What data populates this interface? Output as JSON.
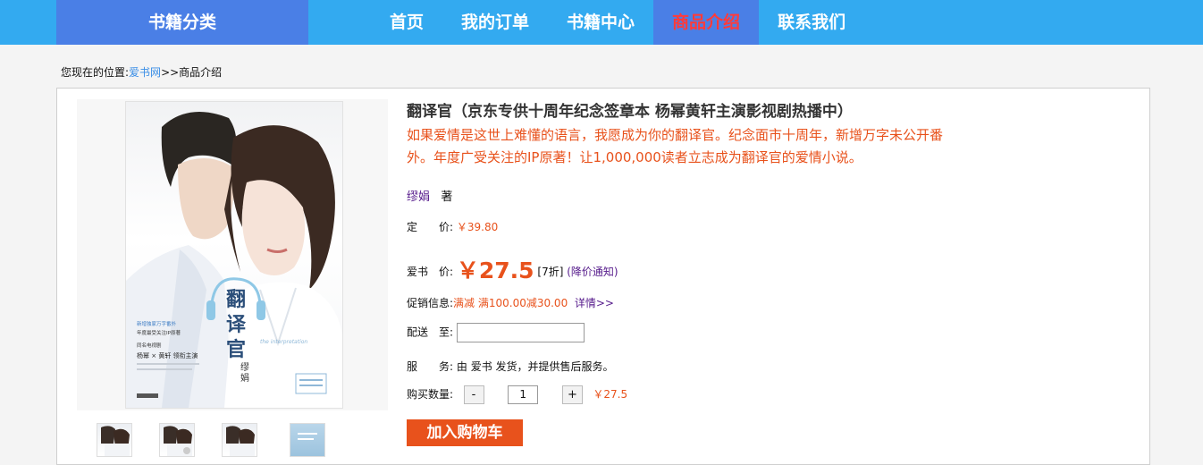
{
  "nav": {
    "category": "书籍分类",
    "items": [
      "首页",
      "我的订单",
      "书籍中心",
      "商品介绍",
      "联系我们"
    ],
    "active_index": 3
  },
  "breadcrumb": {
    "prefix": "您现在的位置:",
    "site": "爱书网",
    "separator": ">>",
    "current": "商品介绍"
  },
  "product": {
    "title": "翻译官（京东专供十周年纪念签章本 杨幂黄轩主演影视剧热播中）",
    "subtitle": "如果爱情是这世上难懂的语言，我愿成为你的翻译官。纪念面市十周年，新增万字未公开番外。年度广受关注的IP原著！让1,000,000读者立志成为翻译官的爱情小说。",
    "author": "缪娟",
    "author_suffix": "著",
    "list_price_label": "定　　价:",
    "list_price": "￥39.80",
    "sale_price_label": "爱书　价:",
    "sale_price": "￥27.5",
    "discount": "[7折]",
    "price_alert": "(降价通知)",
    "promo_label": "促销信息:",
    "promo_text": "满减 满100.00减30.00",
    "promo_link": "详情>>",
    "delivery_label": "配送　至:",
    "delivery_value": "",
    "service_label": "服　　务:",
    "service_text": "由 爱书 发货，并提供售后服务。",
    "qty_label": "购买数量:",
    "qty_minus": "-",
    "qty_value": "1",
    "qty_plus": "+",
    "subtotal": "￥27.5",
    "add_to_cart": "加入购物车"
  },
  "cover": {
    "book_title": "翻译官",
    "author_text": "缪娟",
    "english_text": "the interpretation",
    "line1": "新增独家万字番外",
    "line2": "年度最受关注IP原著",
    "line3": "同名电视剧",
    "line4": "杨幂 × 黄轩 领衔主演"
  },
  "colors": {
    "topbar": "#33aaf0",
    "category_bg": "#4a7fe6",
    "active_text": "#ff3b3b",
    "accent": "#e8521c"
  }
}
